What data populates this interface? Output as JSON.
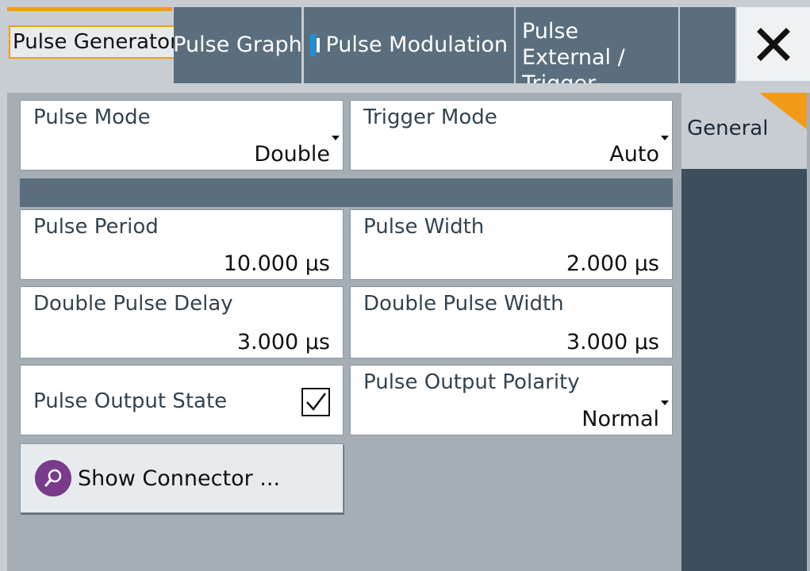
{
  "tabs": {
    "pulse_generator": "Pulse Generator",
    "pulse_graph": "Pulse Graph",
    "pulse_modulation": "Pulse Modulation",
    "pulse_external_trigger": "Pulse External / Trigger"
  },
  "fields": {
    "pulse_mode": {
      "label": "Pulse Mode",
      "value": "Double"
    },
    "trigger_mode": {
      "label": "Trigger Mode",
      "value": "Auto"
    },
    "pulse_period": {
      "label": "Pulse Period",
      "value": "10.000 µs"
    },
    "pulse_width": {
      "label": "Pulse Width",
      "value": "2.000 µs"
    },
    "double_pulse_delay": {
      "label": "Double Pulse Delay",
      "value": "3.000 µs"
    },
    "double_pulse_width": {
      "label": "Double Pulse Width",
      "value": "3.000 µs"
    },
    "pulse_output_state": {
      "label": "Pulse Output State",
      "checked": true
    },
    "pulse_output_polarity": {
      "label": "Pulse Output Polarity",
      "value": "Normal"
    }
  },
  "buttons": {
    "show_connector": "Show Connector ..."
  },
  "side_tabs": {
    "general": "General"
  },
  "colors": {
    "accent": "#f29b18",
    "tab_bg": "#5a6e7d",
    "panel_bg": "#a5aeb5",
    "modulation_indicator": "#1e90d8",
    "connector_icon": "#7a3b8c"
  },
  "icons": {
    "close": "close-icon",
    "connector": "search-icon",
    "modulation_state": "modulation-on-icon",
    "dropdown": "dropdown-arrow-icon",
    "checkbox": "checkmark-icon"
  }
}
